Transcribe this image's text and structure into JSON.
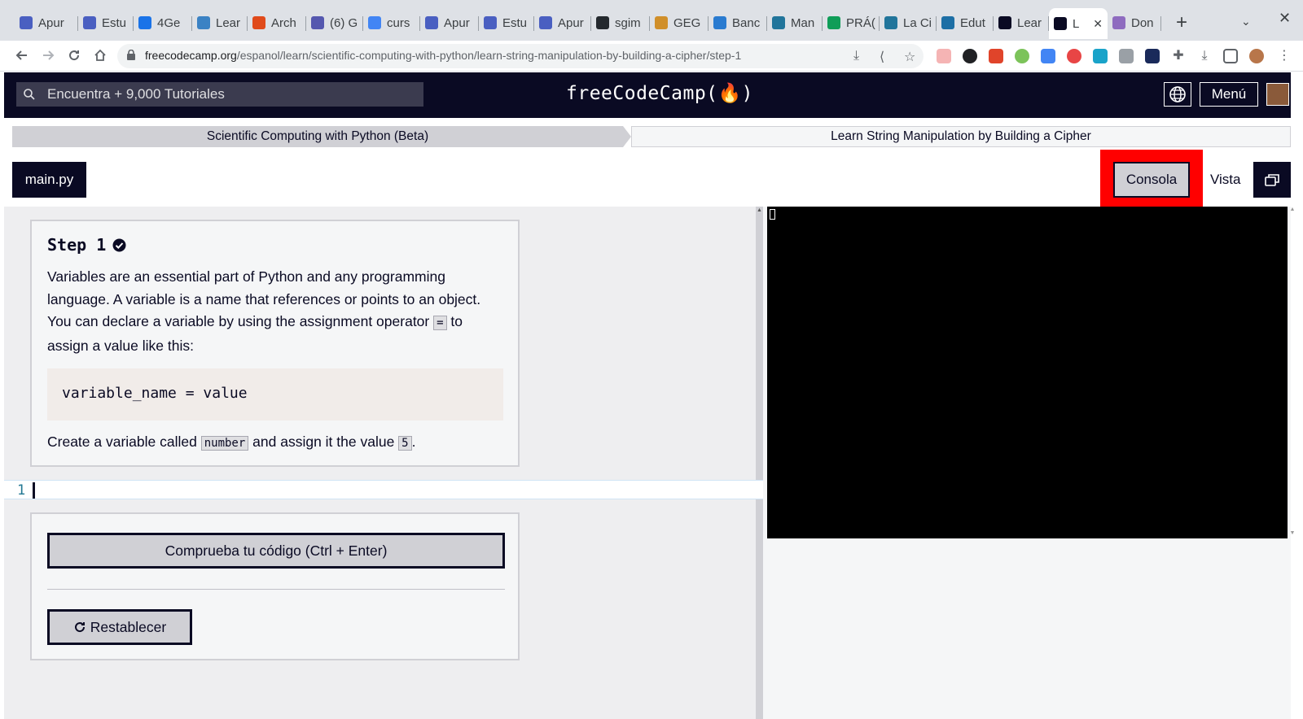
{
  "browser": {
    "tabs": [
      {
        "label": "Apur",
        "icon": "doc-icon",
        "color": "#4a5fc1"
      },
      {
        "label": "Estu",
        "icon": "doc-icon",
        "color": "#4a5fc1"
      },
      {
        "label": "4Ge",
        "icon": "circle-k-icon",
        "color": "#1a73e8"
      },
      {
        "label": "Lear",
        "icon": "cube-icon",
        "color": "#3b82c4"
      },
      {
        "label": "Arch",
        "icon": "pe-icon",
        "color": "#e04a1a"
      },
      {
        "label": "(6) G",
        "icon": "teams-icon",
        "color": "#5558af"
      },
      {
        "label": "curs",
        "icon": "google-icon",
        "color": "#4285f4"
      },
      {
        "label": "Apur",
        "icon": "doc-icon",
        "color": "#4a5fc1"
      },
      {
        "label": "Estu",
        "icon": "doc-icon",
        "color": "#4a5fc1"
      },
      {
        "label": "Apur",
        "icon": "doc-icon",
        "color": "#4a5fc1"
      },
      {
        "label": "sgim",
        "icon": "github-icon",
        "color": "#24292e"
      },
      {
        "label": "GEG",
        "icon": "geg-icon",
        "color": "#d08f2a"
      },
      {
        "label": "Banc",
        "icon": "bank-icon",
        "color": "#2a7bd0"
      },
      {
        "label": "Man",
        "icon": "wordpress-icon",
        "color": "#21759b"
      },
      {
        "label": "PRÁ(",
        "icon": "drive-icon",
        "color": "#0f9d58"
      },
      {
        "label": "La Ci",
        "icon": "wordpress-icon",
        "color": "#21759b"
      },
      {
        "label": "Edut",
        "icon": "edu-icon",
        "color": "#1d6fa5"
      },
      {
        "label": "Lear",
        "icon": "fcc-icon",
        "color": "#0a0a23"
      },
      {
        "label": "L",
        "icon": "fcc-icon",
        "color": "#0a0a23",
        "active": true
      },
      {
        "label": "Don",
        "icon": "donate-icon",
        "color": "#8e6bbf"
      }
    ],
    "new_tab": "+",
    "tab_search": "⌄",
    "window_close": "✕",
    "url_host": "freecodecamp.org",
    "url_path": "/espanol/learn/scientific-computing-with-python/learn-string-manipulation-by-building-a-cipher/step-1"
  },
  "nav": {
    "search_placeholder": "Encuentra + 9,000 Tutoriales",
    "logo": "freeCodeCamp(🔥)",
    "menu_label": "Menú"
  },
  "breadcrumb": {
    "superblock": "Scientific Computing with Python (Beta)",
    "block": "Learn String Manipulation by Building a Cipher"
  },
  "toolbar": {
    "file_tab": "main.py",
    "console_label": "Consola",
    "preview_label": "Vista"
  },
  "instructions": {
    "step_title": "Step 1",
    "desc_part1": "Variables are an essential part of Python and any programming language. A variable is a name that references or points to an object. You can declare a variable by using the assignment operator ",
    "desc_code": "=",
    "desc_part2": " to assign a value like this:",
    "code_example": "variable_name = value",
    "task_part1": "Create a variable called ",
    "task_code1": "number",
    "task_part2": " and assign it the value ",
    "task_code2": "5",
    "task_part3": "."
  },
  "editor": {
    "line_number": "1"
  },
  "actions": {
    "check_label": "Comprueba tu código (Ctrl + Enter)",
    "reset_label": "Restablecer"
  },
  "colors": {
    "fcc_dark": "#0a0a23",
    "highlight_red": "#ff0000",
    "console_bg": "#000000"
  }
}
